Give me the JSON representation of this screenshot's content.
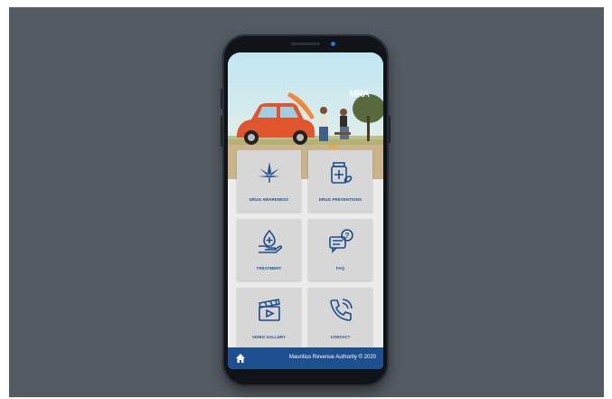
{
  "tiles": [
    {
      "label": "DRUG AWARENESS",
      "icon": "cannabis-leaf-icon"
    },
    {
      "label": "DRUG PREVENTIONS",
      "icon": "medicine-bottle-icon"
    },
    {
      "label": "TREATMENT",
      "icon": "hand-drop-icon"
    },
    {
      "label": "FAQ",
      "icon": "question-chat-icon"
    },
    {
      "label": "VIDEO GALLERY",
      "icon": "clapperboard-icon"
    },
    {
      "label": "CONTACT",
      "icon": "phone-icon"
    }
  ],
  "footer": {
    "text": "Mauritius Revenue Authority © 2020",
    "home_icon": "home-icon"
  },
  "colors": {
    "accent": "#1d4f8f",
    "tile_bg": "#d7d7d7",
    "backdrop": "#545b63"
  }
}
